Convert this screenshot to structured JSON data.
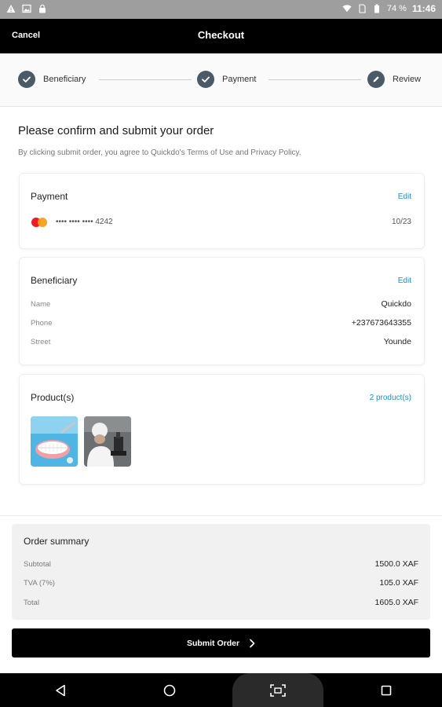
{
  "status_bar": {
    "battery": "74 %",
    "time": "11:46"
  },
  "header": {
    "cancel_label": "Cancel",
    "title": "Checkout"
  },
  "stepper": {
    "steps": [
      {
        "label": "Beneficiary",
        "state": "completed",
        "icon": "check-icon"
      },
      {
        "label": "Payment",
        "state": "completed",
        "icon": "check-icon"
      },
      {
        "label": "Review",
        "state": "current",
        "icon": "pencil-icon"
      }
    ]
  },
  "main": {
    "heading": "Please confirm and submit your order",
    "subtext": "By clicking submit order, you agree to Quickdo's Terms of Use and Privacy Policy."
  },
  "payment": {
    "title": "Payment",
    "edit_label": "Edit",
    "card_masked": "•••• •••• •••• 4242",
    "expiry": "10/23",
    "card_brand_icon": "mastercard-icon"
  },
  "beneficiary": {
    "title": "Beneficiary",
    "edit_label": "Edit",
    "rows": [
      {
        "label": "Name",
        "value": "Quickdo"
      },
      {
        "label": "Phone",
        "value": "+237673643355"
      },
      {
        "label": "Street",
        "value": "Younde"
      }
    ]
  },
  "products": {
    "title": "Product(s)",
    "count_label": "2 product(s)"
  },
  "order_summary": {
    "title": "Order summary",
    "rows": [
      {
        "label": "Subtotal",
        "value": "1500.0 XAF"
      },
      {
        "label": "TVA (7%)",
        "value": "105.0 XAF"
      },
      {
        "label": "Total",
        "value": "1605.0 XAF"
      }
    ]
  },
  "submit_label": "Submit Order",
  "colors": {
    "accent_link": "#1e8fd0",
    "step_circle": "#4a5a66",
    "bar": "#000000"
  }
}
